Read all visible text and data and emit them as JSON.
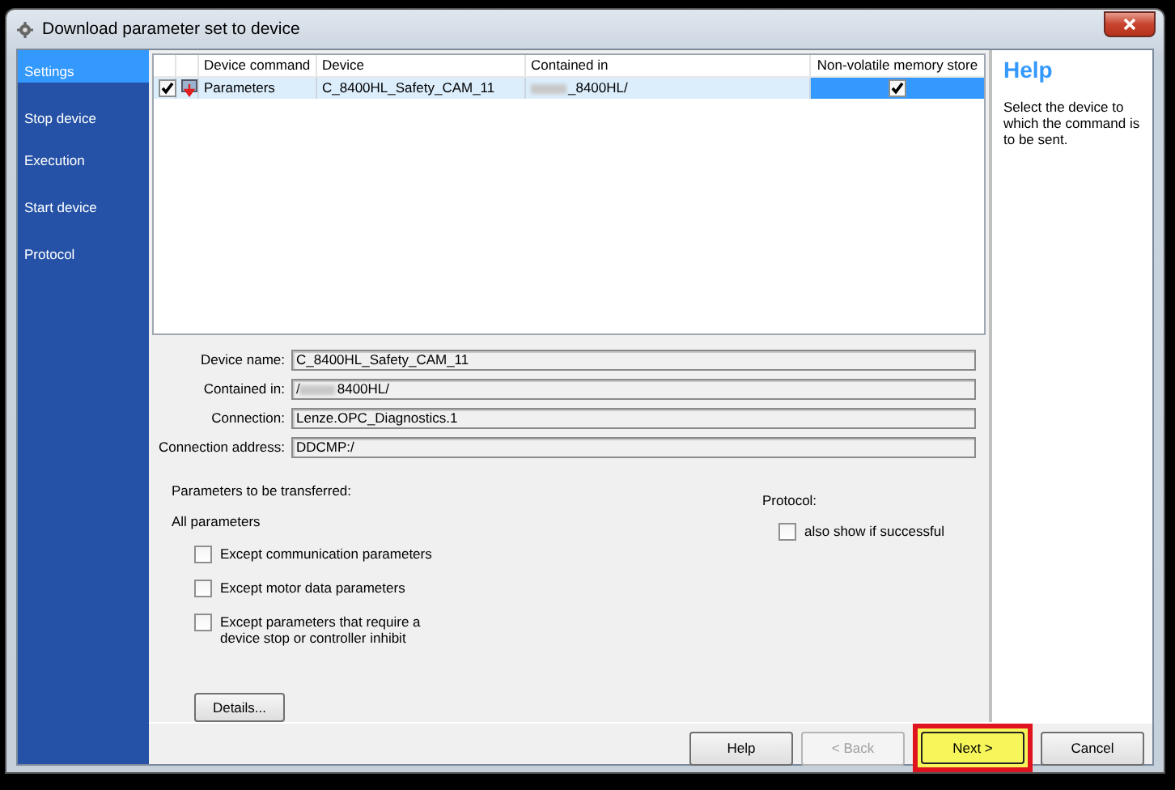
{
  "window": {
    "title": "Download parameter set to device"
  },
  "sidebar": {
    "items": [
      {
        "label": "Settings",
        "selected": true
      },
      {
        "label": "Stop device",
        "selected": false
      },
      {
        "label": "Execution",
        "selected": false
      },
      {
        "label": "Start device",
        "selected": false
      },
      {
        "label": "Protocol",
        "selected": false
      }
    ]
  },
  "table": {
    "columns": [
      "Device command",
      "Device",
      "Contained in",
      "Non-volatile memory store"
    ],
    "rows": [
      {
        "checked": true,
        "selected": true,
        "command": "Parameters",
        "device": "C_8400HL_Safety_CAM_11",
        "contained_in": "_8400HL/",
        "contained_in_redacted": true,
        "nonvolatile": true
      }
    ]
  },
  "fields": [
    {
      "label": "Device name:",
      "value": "C_8400HL_Safety_CAM_11"
    },
    {
      "label": "Contained in:",
      "value": "/",
      "redacted": true,
      "value_after": "8400HL/"
    },
    {
      "label": "Connection:",
      "value": "Lenze.OPC_Diagnostics.1"
    },
    {
      "label": "Connection address:",
      "value": "DDCMP:/"
    }
  ],
  "transfer": {
    "title": "Parameters to be transferred:",
    "scope": "All parameters",
    "options": [
      {
        "label": "Except communication parameters",
        "checked": false
      },
      {
        "label": "Except motor data parameters",
        "checked": false
      },
      {
        "label": "Except parameters that require a device stop or controller inhibit",
        "checked": false
      }
    ]
  },
  "protocol": {
    "title": "Protocol:",
    "option": {
      "label": "also show if successful",
      "checked": false
    }
  },
  "details_button": "Details...",
  "help": {
    "title": "Help",
    "text": "Select the device to which the command is to be sent."
  },
  "buttons": [
    {
      "label": "Help",
      "disabled": false,
      "highlighted": false
    },
    {
      "label": "< Back",
      "disabled": true,
      "highlighted": false
    },
    {
      "label": "Next >",
      "disabled": false,
      "highlighted": true
    },
    {
      "label": "Cancel",
      "disabled": false,
      "highlighted": false
    }
  ]
}
